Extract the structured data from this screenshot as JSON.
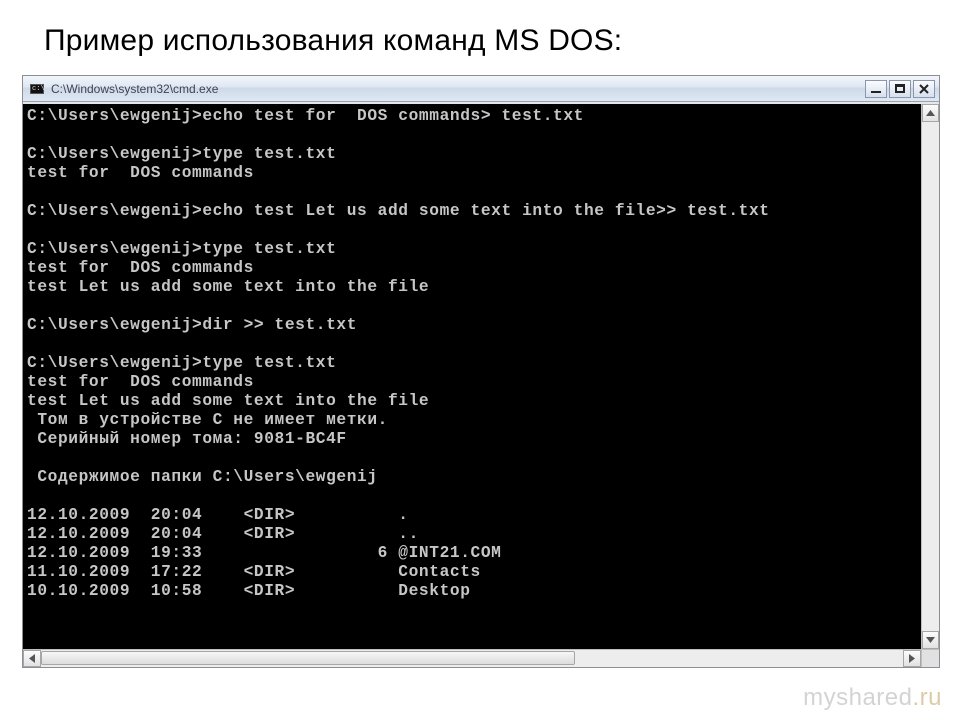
{
  "heading": "Пример использования команд MS DOS:",
  "window": {
    "title": "C:\\Windows\\system32\\cmd.exe"
  },
  "terminal_lines": [
    "C:\\Users\\ewgenij>echo test for  DOS commands> test.txt",
    "",
    "C:\\Users\\ewgenij>type test.txt",
    "test for  DOS commands",
    "",
    "C:\\Users\\ewgenij>echo test Let us add some text into the file>> test.txt",
    "",
    "C:\\Users\\ewgenij>type test.txt",
    "test for  DOS commands",
    "test Let us add some text into the file",
    "",
    "C:\\Users\\ewgenij>dir >> test.txt",
    "",
    "C:\\Users\\ewgenij>type test.txt",
    "test for  DOS commands",
    "test Let us add some text into the file",
    " Том в устройстве C не имеет метки.",
    " Серийный номер тома: 9081-BC4F",
    "",
    " Содержимое папки C:\\Users\\ewgenij",
    "",
    "12.10.2009  20:04    <DIR>          .",
    "12.10.2009  20:04    <DIR>          ..",
    "12.10.2009  19:33                 6 @INT21.COM",
    "11.10.2009  17:22    <DIR>          Contacts",
    "10.10.2009  10:58    <DIR>          Desktop"
  ],
  "watermark": {
    "base": "myshared",
    "tld": ".ru"
  }
}
